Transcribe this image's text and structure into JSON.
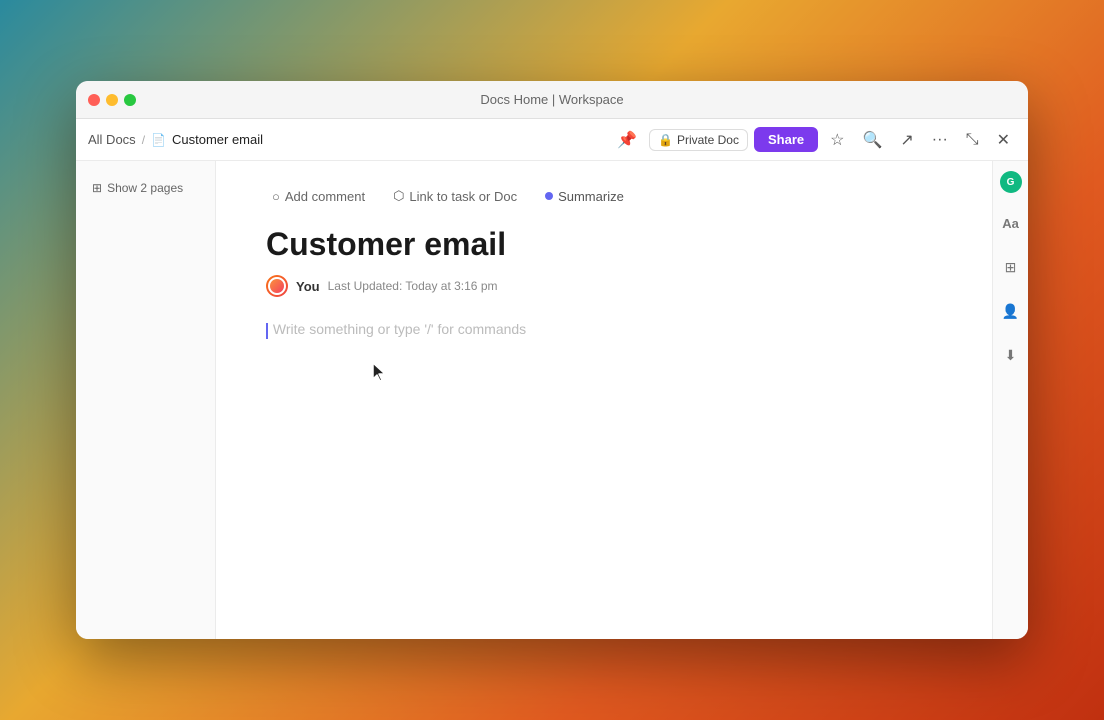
{
  "window": {
    "title": "Docs Home | Workspace"
  },
  "titlebar": {
    "title": "Docs Home | Workspace"
  },
  "breadcrumb": {
    "parent": "All Docs",
    "separator": "/",
    "icon": "📄",
    "current": "Customer email"
  },
  "toolbar": {
    "private_doc_label": "Private Doc",
    "share_label": "Share"
  },
  "sidebar": {
    "show_pages_label": "Show 2 pages"
  },
  "doc_actions": {
    "add_comment": "Add comment",
    "link_task": "Link to task or Doc",
    "summarize": "Summarize"
  },
  "document": {
    "title": "Customer email",
    "author": "You",
    "last_updated": "Last Updated: Today at 3:16 pm",
    "placeholder": "Write something or type '/' for commands"
  },
  "right_sidebar": {
    "online_count": "G"
  }
}
